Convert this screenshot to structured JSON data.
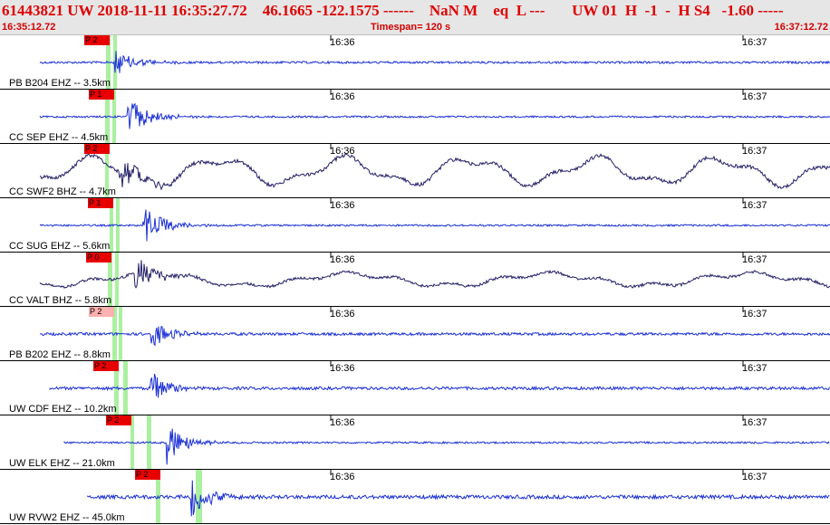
{
  "header": {
    "event_info": "61443821 UW 2018-11-11 16:35:27.72    46.1665 -122.1575 ------    NaN M    eq  L ---       UW 01  H  -1  -  H S4   -1.60 -----",
    "start_time": "16:35:12.72",
    "timespan": "Timespan= 120 s",
    "end_time": "16:37:12.72"
  },
  "colors": {
    "trace_blue": "#1a2fd6",
    "trace_dark": "#241f66",
    "pick_red": "#e80000",
    "pick_pink": "#ffb0b0",
    "phase_green": "#aaf0a0",
    "header_red": "#e00000"
  },
  "time_labels": {
    "first": "16:36",
    "second": "16:37"
  },
  "panels": [
    {
      "station": "PB B204 EHZ -- 3.5km",
      "pick": "P 2",
      "pick_color": "red",
      "trace_color": "blue",
      "amp_noise": 1.2,
      "amp_event": 14,
      "lowfreq": 0,
      "start_frac": 0.0,
      "onset": 0.095
    },
    {
      "station": "CC SEP EHZ -- 4.5km",
      "pick": "P 1",
      "pick_color": "red",
      "trace_color": "blue",
      "amp_noise": 1.0,
      "amp_event": 22,
      "lowfreq": 0,
      "start_frac": 0.0,
      "onset": 0.11
    },
    {
      "station": "CC SWF2 BHZ -- 4.7km",
      "pick": "P 2",
      "pick_color": "red",
      "trace_color": "dark",
      "amp_noise": 2.0,
      "amp_event": 20,
      "lowfreq": 16,
      "start_frac": 0.0,
      "onset": 0.1
    },
    {
      "station": "CC SUG EHZ -- 5.6km",
      "pick": "P 1",
      "pick_color": "red",
      "trace_color": "blue",
      "amp_noise": 1.0,
      "amp_event": 22,
      "lowfreq": 0,
      "start_frac": 0.0,
      "onset": 0.13
    },
    {
      "station": "CC VALT BHZ -- 5.8km",
      "pick": "P 0",
      "pick_color": "red",
      "trace_color": "dark",
      "amp_noise": 1.5,
      "amp_event": 20,
      "lowfreq": 8,
      "start_frac": 0.0,
      "onset": 0.12
    },
    {
      "station": "PB B202 EHZ -- 8.8km",
      "pick": "P 2",
      "pick_color": "pink",
      "trace_color": "blue",
      "amp_noise": 1.5,
      "amp_event": 15,
      "lowfreq": 0,
      "start_frac": 0.0,
      "onset": 0.14
    },
    {
      "station": "UW CDF EHZ -- 10.2km",
      "pick": "P 2",
      "pick_color": "red",
      "trace_color": "blue",
      "amp_noise": 1.6,
      "amp_event": 22,
      "lowfreq": 0,
      "start_frac": 0.012,
      "onset": 0.14
    },
    {
      "station": "UW ELK EHZ -- 21.0km",
      "pick": "P 2",
      "pick_color": "red",
      "trace_color": "blue",
      "amp_noise": 1.0,
      "amp_event": 25,
      "lowfreq": 0,
      "start_frac": 0.03,
      "onset": 0.16
    },
    {
      "station": "UW RVW2 EHZ -- 45.0km",
      "pick": "P 2",
      "pick_color": "red",
      "trace_color": "blue",
      "amp_noise": 2.0,
      "amp_event": 26,
      "lowfreq": 0,
      "start_frac": 0.06,
      "onset": 0.19
    }
  ]
}
